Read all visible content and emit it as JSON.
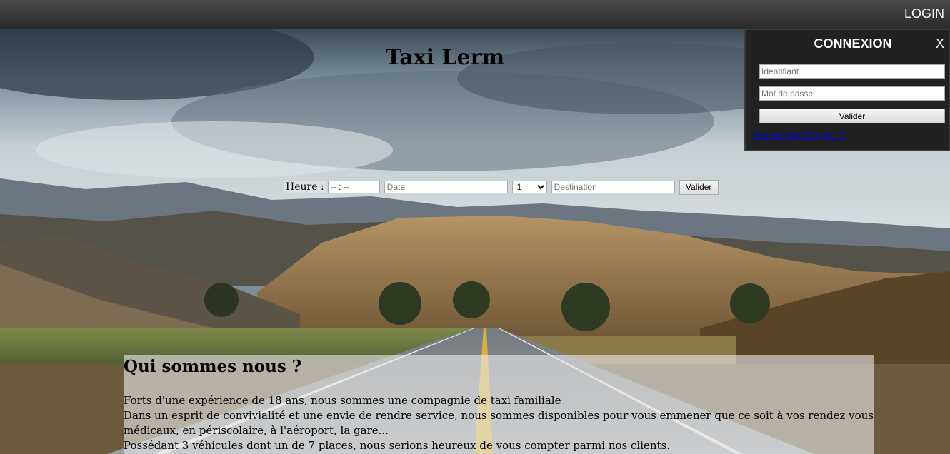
{
  "header": {
    "login_label": "LOGIN"
  },
  "site": {
    "title": "Taxi Lerm"
  },
  "booking": {
    "time_label": "Heure :",
    "time_value": "-- : --",
    "date_placeholder": "Date",
    "passengers_selected": "1",
    "destination_placeholder": "Destination",
    "submit_label": "Valider"
  },
  "login_panel": {
    "title": "CONNEXION",
    "close_label": "X",
    "username_placeholder": "Identifiant",
    "password_placeholder": "Mot de passe",
    "submit_label": "Valider",
    "signup_link": "Pas encore inscrit ?"
  },
  "about": {
    "heading": "Qui sommes nous ?",
    "lines": [
      "Forts d'une expérience de 18 ans, nous sommes une compagnie de taxi familiale",
      "Dans un esprit de convivialité et une envie de rendre service, nous sommes disponibles pour vous emmener que ce soit à vos rendez vous médicaux, en périscolaire, à l'aéroport, la gare...",
      "Possédant 3 véhicules dont un de 7 places, nous serions heureux de vous compter parmi nos clients."
    ]
  },
  "colors": {
    "topbar": "#2a2a2a",
    "panel": "#212121",
    "link": "#0000ee"
  }
}
